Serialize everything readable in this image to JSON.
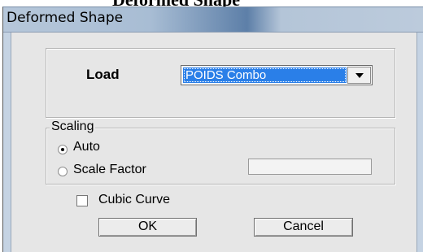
{
  "background_heading": "Deformed Shape",
  "window": {
    "title": "Deformed Shape"
  },
  "load": {
    "label": "Load",
    "selected": "POIDS Combo"
  },
  "scaling": {
    "legend": "Scaling",
    "auto_label": "Auto",
    "auto_checked": true,
    "scale_factor_label": "Scale Factor",
    "scale_factor_value": ""
  },
  "cubic_curve": {
    "label": "Cubic Curve",
    "checked": false
  },
  "buttons": {
    "ok": "OK",
    "cancel": "Cancel"
  },
  "colors": {
    "selection": "#2a7fe8",
    "dialog_bg": "#e6e6e6"
  }
}
